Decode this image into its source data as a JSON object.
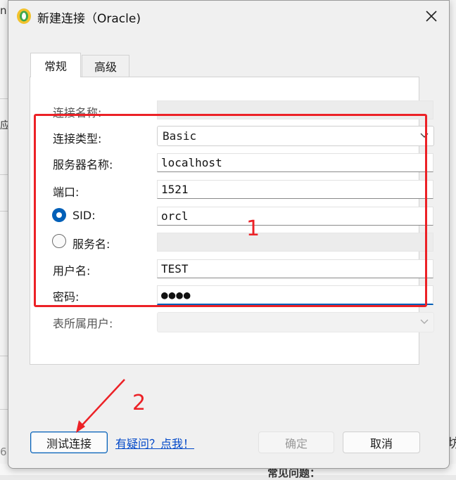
{
  "dialog": {
    "title": "新建连接（Oracle)",
    "icon": "navicat-app-icon",
    "close_icon": "close-icon"
  },
  "tabs": [
    {
      "label": "常规",
      "active": true
    },
    {
      "label": "高级",
      "active": false
    }
  ],
  "form": {
    "connection_name": {
      "label": "连接名称:",
      "value": ""
    },
    "connection_type": {
      "label": "连接类型:",
      "value": "Basic"
    },
    "host": {
      "label": "服务器名称:",
      "value": "localhost"
    },
    "port": {
      "label": "端口:",
      "value": "1521"
    },
    "sid": {
      "label": "SID:",
      "value": "orcl",
      "selected": true
    },
    "service_name": {
      "label": "服务名:",
      "value": "",
      "selected": false
    },
    "username": {
      "label": "用户名:",
      "value": "TEST"
    },
    "password": {
      "label": "密码:",
      "value": "●●●●"
    },
    "table_owner": {
      "label": "表所属用户:",
      "value": ""
    }
  },
  "buttons": {
    "test": "测试连接",
    "help_link": "有疑问？点我！",
    "ok": "确定",
    "cancel": "取消"
  },
  "annotations": {
    "box_label": "1",
    "arrow_label": "2",
    "color": "#ec2126"
  },
  "background_fragments": {
    "left_top": "n",
    "left_mid": "应",
    "left_bottom": "6",
    "right_bottom": "坊",
    "bottom_text": "常见问题："
  }
}
